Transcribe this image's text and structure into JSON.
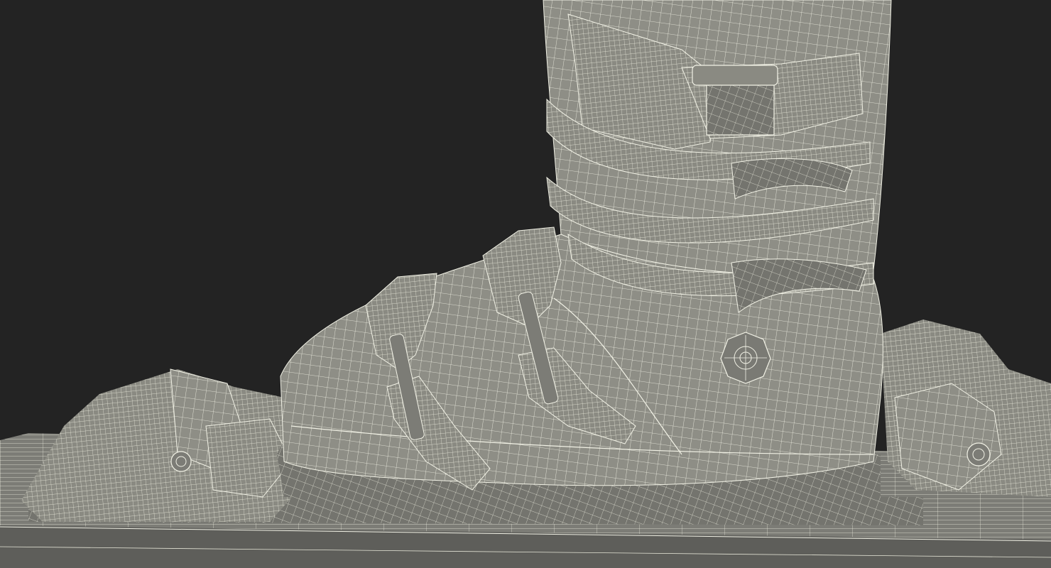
{
  "scene": {
    "colors": {
      "background": "#232323",
      "surface": "#8e8e86",
      "surface_dark": "#6e6e68",
      "surface_light": "#a6a69e",
      "wire": "#f2f2e6",
      "wire_dense": "#e4e4d6"
    }
  }
}
